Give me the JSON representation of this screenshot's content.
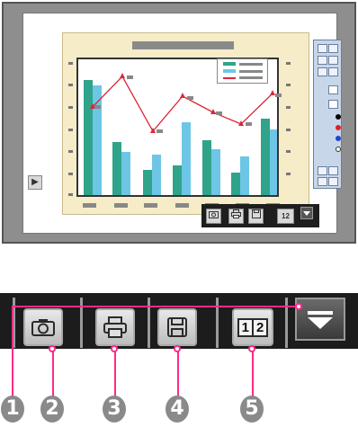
{
  "colors": {
    "bar_a": "#2fa48a",
    "bar_b": "#6ec6e6",
    "line": "#d8283c",
    "leader": "#ff2a8a",
    "callout": "#8a8a8a"
  },
  "icons": {
    "side_arrow": "▶",
    "capture": "camera-icon",
    "print": "printer-icon",
    "save": "floppy-disk-icon",
    "switch": "one-two-icon",
    "collapse": "chevron-down-icon"
  },
  "mini_toolbar": {
    "switch_label": "12"
  },
  "toolbar": {
    "switch_label_1": "1",
    "switch_label_2": "2"
  },
  "callouts": [
    "1",
    "2",
    "3",
    "4",
    "5"
  ]
}
